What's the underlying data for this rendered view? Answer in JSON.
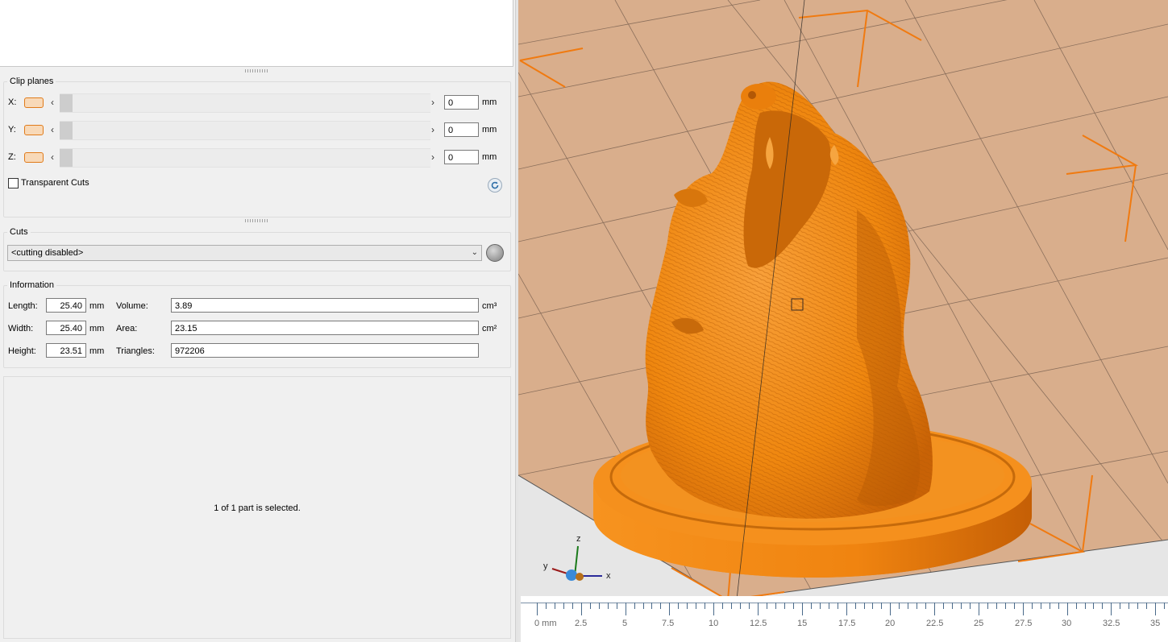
{
  "clip_planes": {
    "title": "Clip planes",
    "rows": [
      {
        "axis": "X:",
        "value": "0",
        "unit": "mm"
      },
      {
        "axis": "Y:",
        "value": "0",
        "unit": "mm"
      },
      {
        "axis": "Z:",
        "value": "0",
        "unit": "mm"
      }
    ],
    "transparent_cuts_label": "Transparent Cuts",
    "transparent_cuts_checked": false
  },
  "cuts": {
    "title": "Cuts",
    "selected": "<cutting disabled>"
  },
  "information": {
    "title": "Information",
    "length": {
      "label": "Length:",
      "value": "25.40",
      "unit": "mm"
    },
    "width": {
      "label": "Width:",
      "value": "25.40",
      "unit": "mm"
    },
    "height": {
      "label": "Height:",
      "value": "23.51",
      "unit": "mm"
    },
    "volume": {
      "label": "Volume:",
      "value": "3.89",
      "unit": "cm³"
    },
    "area": {
      "label": "Area:",
      "value": "23.15",
      "unit": "cm²"
    },
    "triangles": {
      "label": "Triangles:",
      "value": "972206"
    }
  },
  "status": {
    "selection_text": "1 of 1 part is selected."
  },
  "axes_gizmo": {
    "z": "z",
    "y": "y",
    "x": "x"
  },
  "ruler": {
    "unit_first_label": "0 mm",
    "labels": [
      "2.5",
      "5",
      "7.5",
      "10",
      "12.5",
      "15",
      "17.5",
      "20",
      "22.5",
      "25",
      "27.5",
      "30",
      "32.5",
      "35"
    ]
  },
  "colors": {
    "model": "#f28a12",
    "build_plate": "#d9ae8c",
    "bounding_box": "#f07a10",
    "panel_bg": "#f0f0f0"
  }
}
